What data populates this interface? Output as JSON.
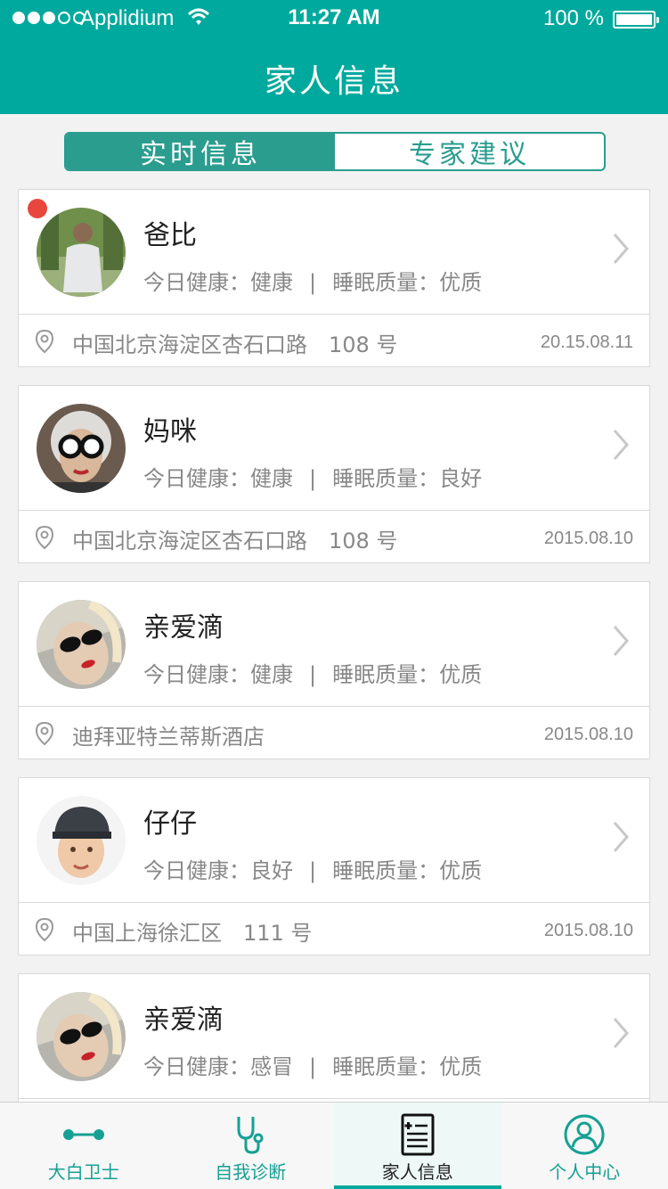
{
  "status_bar": {
    "carrier": "Applidium",
    "time": "11:27 AM",
    "battery": "100 %"
  },
  "header": {
    "title": "家人信息"
  },
  "segment": {
    "tab1": "实时信息",
    "tab2": "专家建议",
    "active": 0
  },
  "labels": {
    "health": "今日健康：",
    "separator": "|",
    "sleep": "睡眠质量："
  },
  "members": [
    {
      "name": "爸比",
      "health": "健康",
      "sleep": "优质",
      "location": "中国北京海淀区杏石口路　108 号",
      "date": "20.15.08.11",
      "unread": true,
      "avatar": "grandpa-photo"
    },
    {
      "name": "妈咪",
      "health": "健康",
      "sleep": "良好",
      "location": "中国北京海淀区杏石口路　108 号",
      "date": "2015.08.10",
      "unread": false,
      "avatar": "grandma-photo"
    },
    {
      "name": "亲爱滴",
      "health": "健康",
      "sleep": "优质",
      "location": "迪拜亚特兰蒂斯酒店",
      "date": "2015.08.10",
      "unread": false,
      "avatar": "woman-sunglasses-photo"
    },
    {
      "name": "仔仔",
      "health": "良好",
      "sleep": "优质",
      "location": "中国上海徐汇区　111 号",
      "date": "2015.08.10",
      "unread": false,
      "avatar": "boy-cap-photo"
    },
    {
      "name": "亲爱滴",
      "health": "感冒",
      "sleep": "优质",
      "location": "",
      "date": "",
      "unread": false,
      "avatar": "woman-sunglasses-photo"
    }
  ],
  "tabbar": {
    "items": [
      {
        "label": "大白卫士",
        "icon": "connection-icon"
      },
      {
        "label": "自我诊断",
        "icon": "stethoscope-icon"
      },
      {
        "label": "家人信息",
        "icon": "medical-record-icon"
      },
      {
        "label": "个人中心",
        "icon": "person-icon"
      }
    ],
    "active": 2
  },
  "colors": {
    "brand": "#00a99d",
    "segment": "#2a9d8f",
    "badge": "#e8473e"
  }
}
